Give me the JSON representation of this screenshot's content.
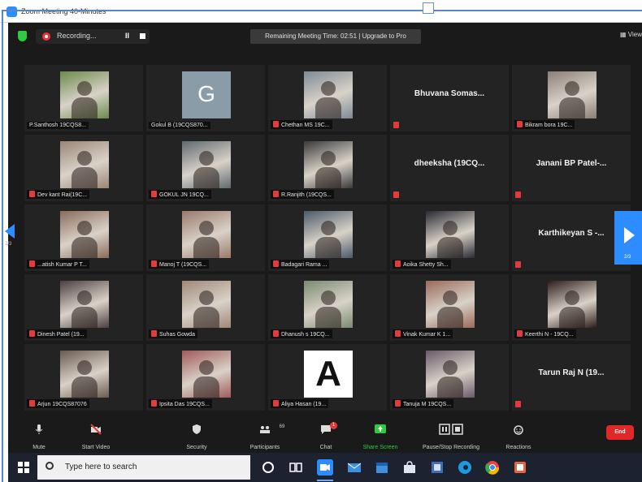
{
  "window": {
    "title": "Zoom Meeting 40-Minutes"
  },
  "topbar": {
    "recording_label": "Recording...",
    "pause_label": "II",
    "banner_text": "Remaining Meeting Time: 02:51 | Upgrade to Pro",
    "view_label": "View"
  },
  "navigation": {
    "left_page": "2/3",
    "right_page": "2/3"
  },
  "participants": [
    {
      "name": "P.Santhosh 19CQS8...",
      "muted": false,
      "tile_type": "photo",
      "color": "#6c8a4c"
    },
    {
      "name": "Gokul B (19CQS870...",
      "muted": false,
      "tile_type": "avatar",
      "avatar_letter": "G",
      "color": "#8a9ca8"
    },
    {
      "name": "Chethan MS 19C...",
      "muted": true,
      "tile_type": "photo",
      "color": "#7e8a96"
    },
    {
      "name": "Bhuvana Somas...",
      "muted": true,
      "tile_type": "name"
    },
    {
      "name": "Bikram bora 19C...",
      "muted": true,
      "tile_type": "photo",
      "color": "#8a7f78"
    },
    {
      "name": "Dev kant Rai(19C...",
      "muted": true,
      "tile_type": "photo",
      "color": "#9a8676"
    },
    {
      "name": "GOKUL JN 19CQ...",
      "muted": true,
      "tile_type": "photo",
      "color": "#5e6a70"
    },
    {
      "name": "R.Ranjith (19CQS...",
      "muted": true,
      "tile_type": "photo",
      "color": "#3a3a3a"
    },
    {
      "name": "dheeksha (19CQ...",
      "muted": true,
      "tile_type": "name"
    },
    {
      "name": "Janani BP Patel-...",
      "muted": true,
      "tile_type": "name"
    },
    {
      "name": "...atish Kumar P T...",
      "muted": true,
      "tile_type": "photo",
      "color": "#8a6c5a"
    },
    {
      "name": "Manoj T (19CQS...",
      "muted": true,
      "tile_type": "photo",
      "color": "#9a7a6a"
    },
    {
      "name": "Badagari Rama ...",
      "muted": true,
      "tile_type": "photo",
      "color": "#4a5a6a"
    },
    {
      "name": "Aoika Shetty Sh...",
      "muted": true,
      "tile_type": "photo",
      "color": "#2a2a34"
    },
    {
      "name": "Karthikeyan S -...",
      "muted": true,
      "tile_type": "name"
    },
    {
      "name": "Dinesh Patel (19...",
      "muted": true,
      "tile_type": "photo",
      "color": "#4a4040"
    },
    {
      "name": "Suhas Gowda",
      "muted": true,
      "tile_type": "photo",
      "color": "#a08878"
    },
    {
      "name": "Dhanush s 19CQ...",
      "muted": true,
      "tile_type": "photo",
      "color": "#7a8a70"
    },
    {
      "name": "Vinak Kumar K 1...",
      "muted": true,
      "tile_type": "photo",
      "color": "#9a6a5a"
    },
    {
      "name": "Keerthi N - 19CQ...",
      "muted": true,
      "tile_type": "photo",
      "color": "#2e1c1c"
    },
    {
      "name": "Arjun 19CQS87076",
      "muted": true,
      "tile_type": "photo",
      "color": "#6a5a50"
    },
    {
      "name": "Ipsita Das 19CQS...",
      "muted": true,
      "tile_type": "photo",
      "color": "#a05a5a"
    },
    {
      "name": "Aliya Hasan (19...",
      "muted": true,
      "tile_type": "letter",
      "avatar_letter": "A"
    },
    {
      "name": "Tanuja M 19CQS...",
      "muted": true,
      "tile_type": "photo",
      "color": "#6a5a6a"
    },
    {
      "name": "Tarun Raj N (19...",
      "muted": true,
      "tile_type": "name"
    }
  ],
  "toolbar": {
    "mute_label": "Mute",
    "video_label": "Start Video",
    "security_label": "Security",
    "participants_label": "Participants",
    "participants_count": "69",
    "chat_label": "Chat",
    "chat_badge": "1",
    "share_label": "Share Screen",
    "recording_label": "Pause/Stop Recording",
    "reactions_label": "Reactions",
    "end_label": "End"
  },
  "taskbar": {
    "search_placeholder": "Type here to search"
  },
  "colors": {
    "accent": "#2d8cff",
    "end": "#e02828",
    "share": "#2ecc40",
    "mute": "#e33b3b"
  }
}
